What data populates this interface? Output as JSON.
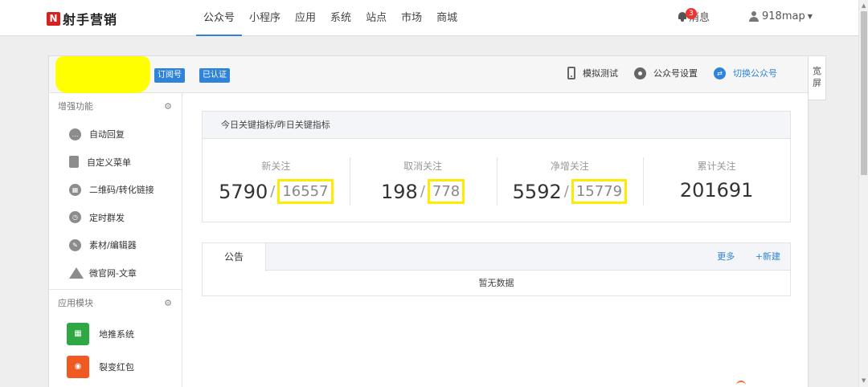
{
  "brand": {
    "logo_mark": "N",
    "name": "射手营销"
  },
  "nav": {
    "items": [
      {
        "label": "公众号",
        "active": true
      },
      {
        "label": "小程序"
      },
      {
        "label": "应用"
      },
      {
        "label": "系统"
      },
      {
        "label": "站点"
      },
      {
        "label": "市场"
      },
      {
        "label": "商城"
      }
    ]
  },
  "header": {
    "messages": {
      "label": "消息",
      "count": "3"
    },
    "user": {
      "name": "918map"
    }
  },
  "account": {
    "name": "",
    "tags": [
      "订阅号",
      "已认证"
    ],
    "actions": {
      "simulate": "模拟测试",
      "settings": "公众号设置",
      "switch": "切换公众号"
    }
  },
  "side_tab": {
    "line1": "宽",
    "line2": "屏"
  },
  "sidebar": {
    "enhance_title": "增强功能",
    "enhance_items": [
      {
        "label": "自动回复",
        "icon": "chat-icon"
      },
      {
        "label": "自定义菜单",
        "icon": "document-icon"
      },
      {
        "label": "二维码/转化链接",
        "icon": "qrcode-icon"
      },
      {
        "label": "定时群发",
        "icon": "clock-icon"
      },
      {
        "label": "素材/编辑器",
        "icon": "edit-icon"
      },
      {
        "label": "微官网-文章",
        "icon": "house-icon"
      }
    ],
    "apps_title": "应用模块",
    "app_items": [
      {
        "label": "地推系统",
        "icon": "grid-icon",
        "color": "#2ea843"
      },
      {
        "label": "裂变红包",
        "icon": "redpacket-icon",
        "color": "#f05a22"
      }
    ]
  },
  "stats": {
    "title": "今日关键指标/昨日关键指标",
    "items": [
      {
        "label": "新关注",
        "today": "5790",
        "yesterday": "16557"
      },
      {
        "label": "取消关注",
        "today": "198",
        "yesterday": "778"
      },
      {
        "label": "净增关注",
        "today": "5592",
        "yesterday": "15779"
      },
      {
        "label": "累计关注",
        "today": "201691"
      }
    ]
  },
  "notice": {
    "tab": "公告",
    "more": "更多",
    "new": "+新建",
    "empty": "暂无数据"
  },
  "colors": {
    "accent": "#2f83d8",
    "highlight": "#ffeb00",
    "brand_red": "#d6211f"
  }
}
